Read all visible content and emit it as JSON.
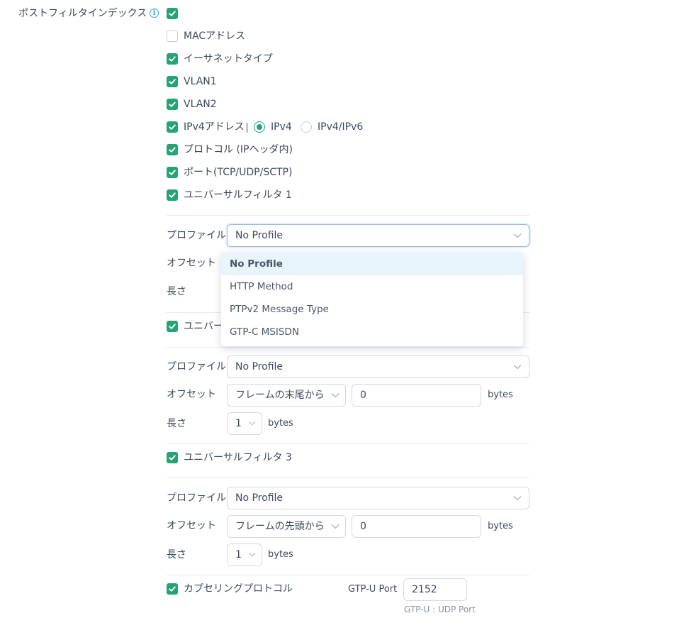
{
  "post_filter_index": {
    "label": "ポストフィルタインデックス",
    "checked": true,
    "info_icon": "info-icon"
  },
  "options": [
    {
      "label": "MACアドレス",
      "checked": false
    },
    {
      "label": "イーサネットタイプ",
      "checked": true
    },
    {
      "label": "VLAN1",
      "checked": true
    },
    {
      "label": "VLAN2",
      "checked": true
    },
    {
      "label": "IPv4アドレス",
      "checked": true
    },
    {
      "label": "プロトコル (IPヘッダ内)",
      "checked": true
    },
    {
      "label": "ポート(TCP/UDP/SCTP)",
      "checked": true
    },
    {
      "label": "ユニバーサルフィルタ 1",
      "checked": true
    }
  ],
  "ip_version": {
    "options": [
      "IPv4",
      "IPv4/IPv6"
    ],
    "selected": "IPv4"
  },
  "filter1": {
    "profile_label": "プロファイル",
    "profile_value": "No Profile",
    "offset_label": "オフセット",
    "length_label": "長さ",
    "dropdown_open": true
  },
  "profile_dropdown": {
    "options": [
      "No Profile",
      "HTTP Method",
      "PTPv2 Message Type",
      "GTP-C MSISDN"
    ],
    "selected": "No Profile"
  },
  "filter2": {
    "title": "ユニバー",
    "checked": true,
    "profile_label": "プロファイル",
    "profile_value": "No Profile",
    "offset_label": "オフセット",
    "offset_mode": "フレームの末尾から",
    "offset_value": "0",
    "offset_unit": "bytes",
    "length_label": "長さ",
    "length_value": "1",
    "length_unit": "bytes"
  },
  "filter3": {
    "title": "ユニバーサルフィルタ 3",
    "checked": true,
    "profile_label": "プロファイル",
    "profile_value": "No Profile",
    "offset_label": "オフセット",
    "offset_mode": "フレームの先頭から",
    "offset_value": "0",
    "offset_unit": "bytes",
    "length_label": "長さ",
    "length_value": "1",
    "length_unit": "bytes"
  },
  "encapsulation": {
    "label": "カプセリングプロトコル",
    "checked": true,
    "gtp_port_label": "GTP-U Port",
    "gtp_port_value": "2152",
    "gtp_port_hint": "GTP-U : UDP Port"
  },
  "colors": {
    "accent": "#24a474",
    "info": "#2aa4e0",
    "text": "#3d4a5c",
    "border": "#d4d9df"
  }
}
